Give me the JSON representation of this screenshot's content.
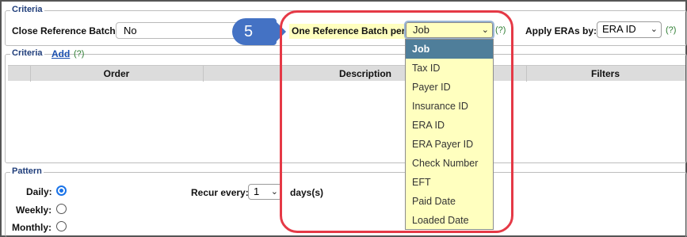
{
  "criteria_top": {
    "legend": "Criteria",
    "close_batch_label": "Close Reference Batch:",
    "close_batch_value": "No",
    "one_ref_label": "One Reference Batch per:",
    "one_ref_value": "Job",
    "one_ref_help": "(?)",
    "apply_label": "Apply ERAs by:",
    "apply_value": "ERA ID",
    "apply_help": "(?)"
  },
  "callout_step": "5",
  "criteria_list": {
    "legend": "Criteria",
    "add_label": "Add",
    "help": "(?)",
    "columns": [
      "Order",
      "Description",
      "Filters"
    ]
  },
  "dropdown_options": [
    "Job",
    "Tax ID",
    "Payer ID",
    "Insurance ID",
    "ERA ID",
    "ERA Payer ID",
    "Check Number",
    "EFT",
    "Paid Date",
    "Loaded Date"
  ],
  "selected_option": "Job",
  "pattern": {
    "legend": "Pattern",
    "options": [
      "Daily:",
      "Weekly:",
      "Monthly:"
    ],
    "selected": "Daily:",
    "recur_label": "Recur every:",
    "recur_value": "1",
    "recur_unit": "days(s)"
  },
  "colors": {
    "accent": "#1a73e8",
    "callout": "#e53946",
    "badge": "#4472c4",
    "highlight": "#ffffbf",
    "selected_row": "#4f7e9a"
  }
}
